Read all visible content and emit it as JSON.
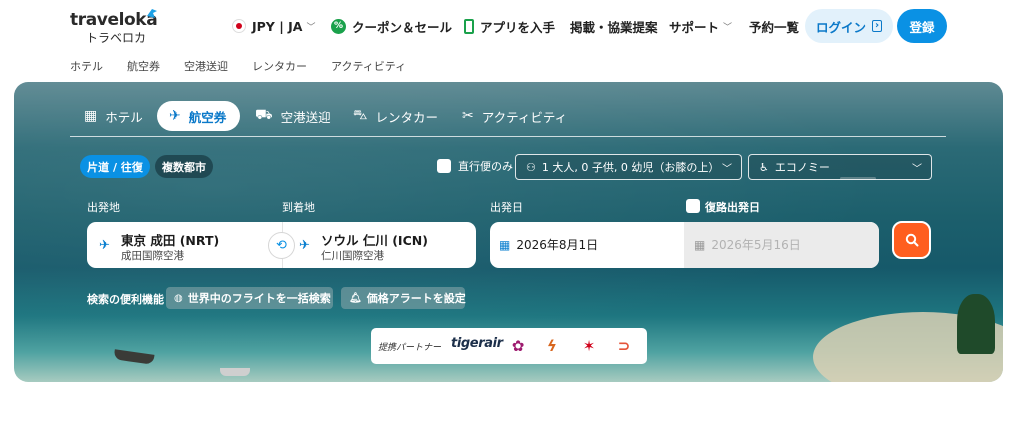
{
  "brand": {
    "name": "traveloka",
    "name_jp": "トラベロカ"
  },
  "header": {
    "locale": "JPY | JA",
    "nav": [
      "クーポン＆セール",
      "アプリを入手",
      "掲載・協業提案",
      "サポート",
      "予約一覧"
    ],
    "login": "ログイン",
    "register": "登録"
  },
  "subnav": [
    "ホテル",
    "航空券",
    "空港送迎",
    "レンタカー",
    "アクティビティ"
  ],
  "tabs": [
    {
      "label": "ホテル",
      "icon": "hotel-icon"
    },
    {
      "label": "航空券",
      "icon": "plane-icon",
      "active": true
    },
    {
      "label": "空港送迎",
      "icon": "car-transfer-icon"
    },
    {
      "label": "レンタカー",
      "icon": "car-rental-icon"
    },
    {
      "label": "アクティビティ",
      "icon": "activity-icon"
    }
  ],
  "search": {
    "trip_types": [
      "片道 / 往復",
      "複数都市"
    ],
    "direct_only": "直行便のみ",
    "passengers": "1 大人, 0 子供, 0 幼児（お膝の上）",
    "cabin_class": "エコノミー",
    "from_label": "出発地",
    "to_label": "到着地",
    "depart_label": "出発日",
    "return_label": "復路出発日",
    "from": {
      "city": "東京 成田 (NRT)",
      "airport": "成田国際空港"
    },
    "to": {
      "city": "ソウル 仁川 (ICN)",
      "airport": "仁川国際空港"
    },
    "depart_date": "2026年8月1日",
    "return_date": "2026年5月16日"
  },
  "features": {
    "label": "検索の便利機能",
    "items": [
      "世界中のフライトを一括検索",
      "価格アラートを設定"
    ]
  },
  "partners": {
    "label": "提携パートナー",
    "tigerair": "tigerair"
  },
  "colors": {
    "primary": "#0a91e4",
    "search": "#ff5e1f"
  }
}
